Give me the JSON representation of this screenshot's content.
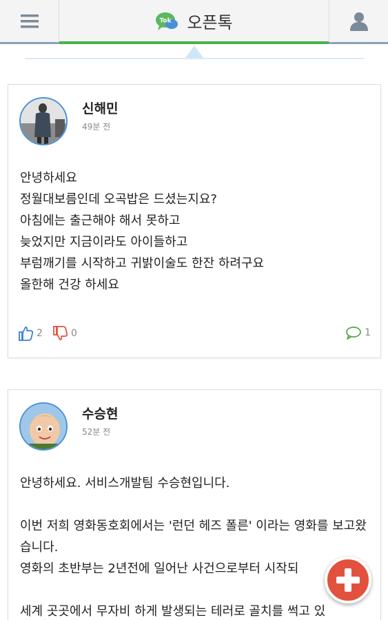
{
  "header": {
    "title": "오픈톡",
    "logo_text": "Tok",
    "menu_icon": "hamburger-menu-icon",
    "profile_icon": "user-profile-icon",
    "accent_color": "#45b34a"
  },
  "posts": [
    {
      "author": "신해민",
      "time": "49분 전",
      "body": "안녕하세요\n정월대보름인데 오곡밥은 드셨는지요?\n아침에는 출근해야 해서 못하고\n늦었지만 지금이라도 아이들하고\n부럼깨기를 시작하고 귀밝이술도 한잔 하려구요\n올한해 건강 하세요",
      "likes": "2",
      "dislikes": "0",
      "comments": "1"
    },
    {
      "author": "수승현",
      "time": "52분 전",
      "body": "안녕하세요. 서비스개발팀 수승현입니다.\n\n이번 저희 영화동호회에서는 '런던 헤즈 폴른' 이라는 영화를 보고왔습니다.\n영화의 초반부는 2년전에 일어난 사건으로부터 시작되\n\n세계 곳곳에서 무자비 하게 발생되는 테러로 골치를 썩고 있"
    }
  ],
  "fab": {
    "icon": "plus-icon",
    "color": "#e2513d"
  }
}
